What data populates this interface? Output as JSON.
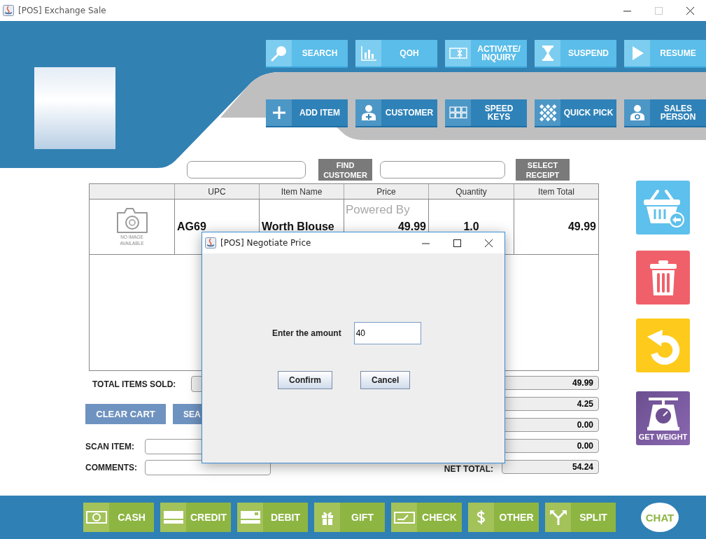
{
  "window": {
    "title": "[POS] Exchange Sale",
    "maximize_disabled": true
  },
  "toolbar_top": [
    {
      "label": "SEARCH",
      "kind": "search"
    },
    {
      "label": "QOH",
      "kind": "chart"
    },
    {
      "label": "ACTIVATE/ INQUIRY",
      "kind": "card"
    },
    {
      "label": "SUSPEND",
      "kind": "hourglass"
    },
    {
      "label": "RESUME",
      "kind": "play"
    }
  ],
  "toolbar_bottom": [
    {
      "label": "ADD ITEM",
      "kind": "plus"
    },
    {
      "label": "CUSTOMER",
      "kind": "person-plus"
    },
    {
      "label": "SPEED KEYS",
      "kind": "keypad"
    },
    {
      "label": "QUICK PICK",
      "kind": "grid"
    },
    {
      "label": "SALES PERSON",
      "kind": "person-dollar"
    }
  ],
  "customer_search": {
    "button": "FIND CUSTOMER"
  },
  "receipt_search": {
    "button": "SELECT RECEIPT"
  },
  "table": {
    "columns": [
      "UPC",
      "Item Name",
      "Price",
      "Quantity",
      "Item Total"
    ],
    "rows": [
      {
        "image_text": "NO IMAGE AVAILABLE",
        "upc": "AG69",
        "item_name": "Worth Blouse",
        "price": "49.99",
        "quantity": "1.0",
        "item_total": "49.99"
      }
    ]
  },
  "background_text": "Powered By",
  "side_actions": [
    {
      "kind": "basket"
    },
    {
      "kind": "trash"
    },
    {
      "kind": "undo"
    },
    {
      "kind": "scale",
      "label": "GET WEIGHT"
    }
  ],
  "total_items_label": "TOTAL ITEMS SOLD:",
  "cart_buttons": [
    "CLEAR CART",
    "SEA"
  ],
  "scan_label": "SCAN ITEM:",
  "comments_label": "COMMENTS:",
  "totals": [
    {
      "value": "49.99"
    },
    {
      "value": "4.25"
    },
    {
      "value": "0.00"
    },
    {
      "value": "0.00"
    },
    {
      "label": "NET TOTAL:",
      "value": "54.24"
    }
  ],
  "payment_buttons": [
    {
      "label": "CASH",
      "kind": "cash"
    },
    {
      "label": "CREDIT",
      "kind": "credit"
    },
    {
      "label": "DEBIT",
      "kind": "debit"
    },
    {
      "label": "GIFT",
      "kind": "gift"
    },
    {
      "label": "CHECK",
      "kind": "check"
    },
    {
      "label": "OTHER",
      "kind": "dollar"
    },
    {
      "label": "SPLIT",
      "kind": "split"
    }
  ],
  "chat": "CHAT",
  "dialog": {
    "title": "[POS] Negotiate Price",
    "label": "Enter the amount",
    "value": "40",
    "buttons": [
      "Confirm",
      "Cancel"
    ]
  }
}
